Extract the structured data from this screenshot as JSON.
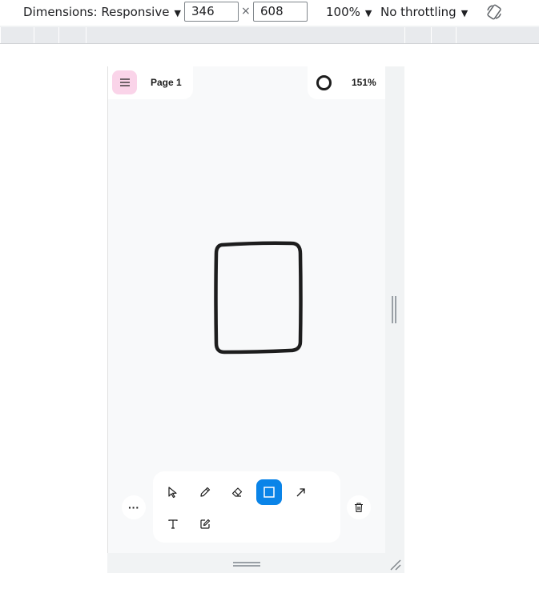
{
  "devtools": {
    "dimensions_label": "Dimensions: Responsive",
    "width_value": "346",
    "times_symbol": "×",
    "height_value": "608",
    "zoom_label": "100%",
    "throttling_label": "No throttling"
  },
  "app": {
    "page_name": "Page 1",
    "zoom": "151%",
    "more_label": "···",
    "selected_tool": "rectangle",
    "tools": [
      {
        "name": "select",
        "icon": "cursor-icon"
      },
      {
        "name": "draw",
        "icon": "pencil-icon"
      },
      {
        "name": "eraser",
        "icon": "eraser-icon"
      },
      {
        "name": "rectangle",
        "icon": "rectangle-icon"
      },
      {
        "name": "arrow",
        "icon": "arrow-icon"
      },
      {
        "name": "text",
        "icon": "text-icon"
      },
      {
        "name": "note",
        "icon": "note-icon"
      }
    ],
    "colors": {
      "menu_bg": "#fad4e9",
      "active_tool": "#0a84e8",
      "stroke": "#1d1d1d"
    }
  }
}
